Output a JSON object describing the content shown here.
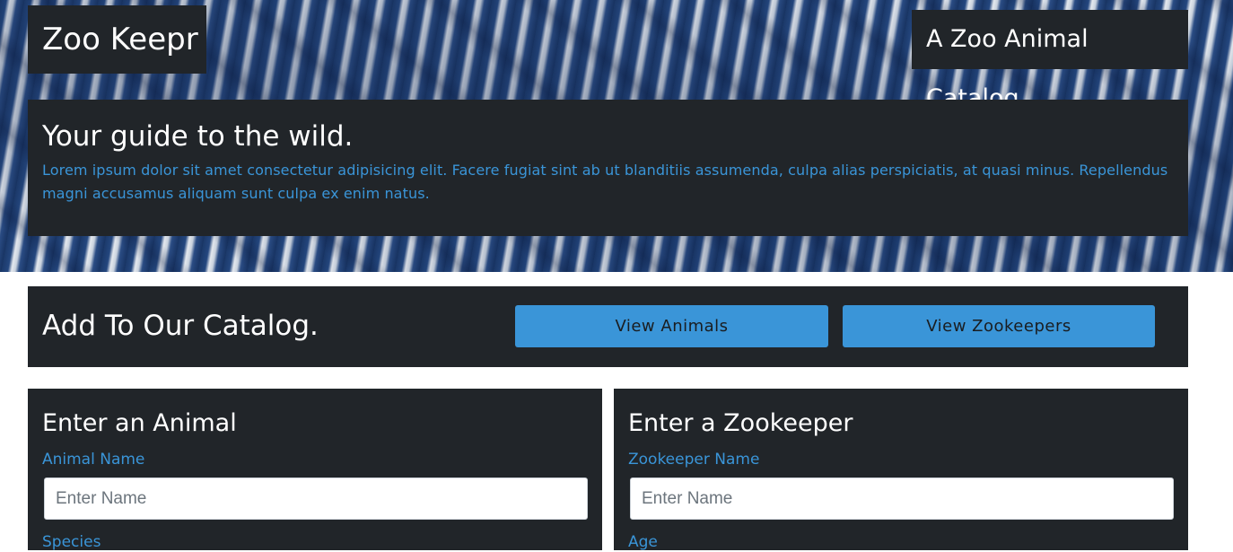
{
  "header": {
    "brand": "Zoo Keepr",
    "tagline": "A Zoo Animal Catalog"
  },
  "intro": {
    "title": "Your guide to the wild.",
    "body": "Lorem ipsum dolor sit amet consectetur adipisicing elit. Facere fugiat sint ab ut blanditiis assumenda, culpa alias perspiciatis, at quasi minus. Repellendus magni accusamus aliquam sunt culpa ex enim natus."
  },
  "catalog": {
    "title": "Add To Our Catalog.",
    "view_animals_label": "View Animals",
    "view_zookeepers_label": "View Zookeepers"
  },
  "animal_form": {
    "title": "Enter an Animal",
    "name_label": "Animal Name",
    "name_placeholder": "Enter Name",
    "name_value": "",
    "next_label": "Species"
  },
  "zookeeper_form": {
    "title": "Enter a Zookeeper",
    "name_label": "Zookeeper Name",
    "name_placeholder": "Enter Name",
    "name_value": "",
    "next_label": "Age"
  },
  "colors": {
    "panel": "#212529",
    "accent": "#3a95d8",
    "hero_stripe_dark": "#1c3a6b",
    "hero_stripe_light": "#e4e8ee"
  }
}
